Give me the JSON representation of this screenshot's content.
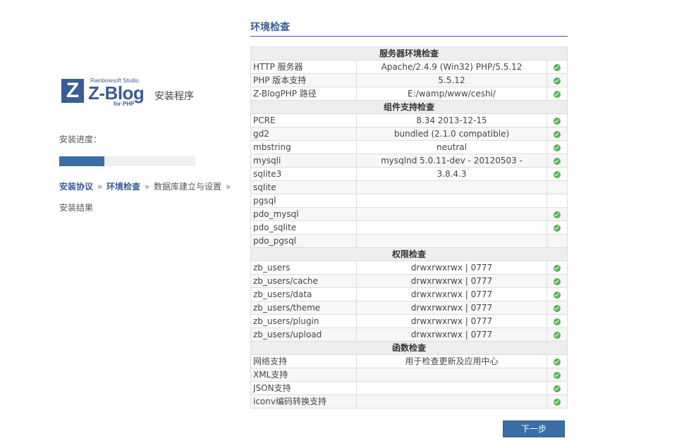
{
  "logo": {
    "studio": "Rainbowsoft Studio",
    "z": "Z",
    "brand": "Z-Blog",
    "forphp": "for PHP",
    "installer": "安装程序"
  },
  "progress": {
    "label": "安装进度：",
    "fraction": 0.33
  },
  "steps": {
    "items": [
      {
        "label": "安装协议",
        "done": true
      },
      {
        "label": "环境检查",
        "done": true
      },
      {
        "label": "数据库建立与设置",
        "done": false
      },
      {
        "label": "安装结果",
        "done": false
      }
    ],
    "separator": "»"
  },
  "title": "环境检查",
  "sections": [
    {
      "heading": "服务器环境检查",
      "rows": [
        {
          "name": "HTTP 服务器",
          "value": "Apache/2.4.9 (Win32) PHP/5.5.12",
          "ok": true
        },
        {
          "name": "PHP 版本支持",
          "value": "5.5.12",
          "ok": true
        },
        {
          "name": "Z-BlogPHP 路径",
          "value": "E:/wamp/www/ceshi/",
          "ok": true
        }
      ]
    },
    {
      "heading": "组件支持检查",
      "rows": [
        {
          "name": "PCRE",
          "value": "8.34 2013-12-15",
          "ok": true
        },
        {
          "name": "gd2",
          "value": "bundled (2.1.0 compatible)",
          "ok": true
        },
        {
          "name": "mbstring",
          "value": "neutral",
          "ok": true
        },
        {
          "name": "mysqli",
          "value": "mysqlnd 5.0.11-dev - 20120503 -",
          "ok": true
        },
        {
          "name": "sqlite3",
          "value": "3.8.4.3",
          "ok": true
        },
        {
          "name": "sqlite",
          "value": "",
          "ok": false
        },
        {
          "name": "pgsql",
          "value": "",
          "ok": false
        },
        {
          "name": "pdo_mysql",
          "value": "",
          "ok": true
        },
        {
          "name": "pdo_sqlite",
          "value": "",
          "ok": true
        },
        {
          "name": "pdo_pgsql",
          "value": "",
          "ok": false
        }
      ]
    },
    {
      "heading": "权限检查",
      "rows": [
        {
          "name": "zb_users",
          "value": "drwxrwxrwx | 0777",
          "ok": true
        },
        {
          "name": "zb_users/cache",
          "value": "drwxrwxrwx | 0777",
          "ok": true
        },
        {
          "name": "zb_users/data",
          "value": "drwxrwxrwx | 0777",
          "ok": true
        },
        {
          "name": "zb_users/theme",
          "value": "drwxrwxrwx | 0777",
          "ok": true
        },
        {
          "name": "zb_users/plugin",
          "value": "drwxrwxrwx | 0777",
          "ok": true
        },
        {
          "name": "zb_users/upload",
          "value": "drwxrwxrwx | 0777",
          "ok": true
        }
      ]
    },
    {
      "heading": "函数检查",
      "rows": [
        {
          "name": "网络支持",
          "value": "用于检查更新及应用中心",
          "ok": true
        },
        {
          "name": "XML支持",
          "value": "",
          "ok": true
        },
        {
          "name": "JSON支持",
          "value": "",
          "ok": true
        },
        {
          "name": "iconv编码转换支持",
          "value": "",
          "ok": true
        }
      ]
    }
  ],
  "next_button": "下一步",
  "colors": {
    "accent": "#3a5d95",
    "ok": "#55b655"
  }
}
